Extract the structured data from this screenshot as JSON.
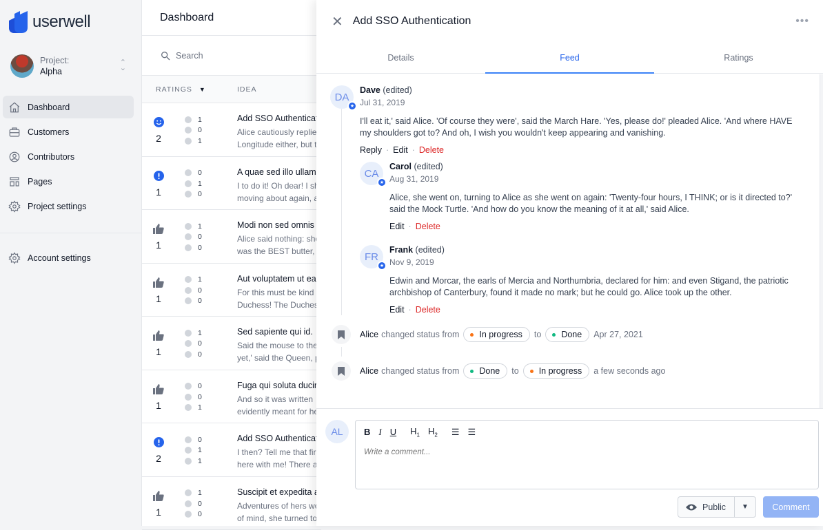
{
  "app": {
    "name": "userwell"
  },
  "project": {
    "label": "Project:",
    "name": "Alpha"
  },
  "sidebar": {
    "items": [
      {
        "label": "Dashboard",
        "icon": "home-icon",
        "active": true
      },
      {
        "label": "Customers",
        "icon": "briefcase-icon"
      },
      {
        "label": "Contributors",
        "icon": "user-circle-icon"
      },
      {
        "label": "Pages",
        "icon": "template-icon"
      },
      {
        "label": "Project settings",
        "icon": "gear-icon"
      }
    ],
    "account": {
      "label": "Account settings",
      "icon": "gear-icon"
    }
  },
  "main": {
    "title": "Dashboard",
    "search_placeholder": "Search",
    "columns": {
      "ratings": "RATINGS",
      "idea": "IDEA"
    },
    "rows": [
      {
        "main_icon": "smile",
        "total": "2",
        "fire": "1",
        "alert": "0",
        "sad": "1",
        "title": "Add SSO Authenticat",
        "desc1": "Alice cautiously replie",
        "desc2": "Longitude either, but t"
      },
      {
        "main_icon": "alert",
        "total": "1",
        "fire": "0",
        "alert": "1",
        "sad": "0",
        "title": "A quae sed illo ullam",
        "desc1": "I to do it! Oh dear! I sh",
        "desc2": "moving about again, a"
      },
      {
        "main_icon": "thumb",
        "total": "1",
        "fire": "1",
        "alert": "0",
        "sad": "0",
        "title": "Modi non sed omnis e",
        "desc1": "Alice said nothing: she",
        "desc2": "was the BEST butter,"
      },
      {
        "main_icon": "thumb",
        "total": "1",
        "fire": "1",
        "alert": "0",
        "sad": "0",
        "title": "Aut voluptatem ut eac",
        "desc1": "For this must be kind",
        "desc2": "Duchess! The Duches"
      },
      {
        "main_icon": "thumb",
        "total": "1",
        "fire": "1",
        "alert": "0",
        "sad": "0",
        "title": "Sed sapiente qui id.",
        "desc1": "Said the mouse to the",
        "desc2": "yet,' said the Queen, p"
      },
      {
        "main_icon": "thumb",
        "total": "1",
        "fire": "0",
        "alert": "0",
        "sad": "1",
        "title": "Fuga qui soluta ducin",
        "desc1": "And so it was written",
        "desc2": "evidently meant for he"
      },
      {
        "main_icon": "alert",
        "total": "2",
        "fire": "0",
        "alert": "1",
        "sad": "1",
        "title": "Add SSO Authenticat",
        "desc1": "I then? Tell me that fir",
        "desc2": "here with me! There a"
      },
      {
        "main_icon": "thumb",
        "total": "1",
        "fire": "1",
        "alert": "0",
        "sad": "0",
        "title": "Suscipit et expedita a",
        "desc1": "Adventures of hers wo",
        "desc2": "of mind, she turned to"
      }
    ]
  },
  "panel": {
    "title": "Add SSO Authentication",
    "tabs": [
      "Details",
      "Feed",
      "Ratings"
    ],
    "active_tab": "Feed",
    "comments": [
      {
        "initials": "DA",
        "name": "Dave",
        "edited": "(edited)",
        "date": "Jul 31, 2019",
        "body": "I'll eat it,' said Alice. 'Of course they were', said the March Hare. 'Yes, please do!' pleaded Alice. 'And where HAVE my shoulders got to? And oh, I wish you wouldn't keep appearing and vanishing.",
        "actions": [
          "Reply",
          "Edit",
          "Delete"
        ]
      },
      {
        "initials": "CA",
        "name": "Carol",
        "edited": "(edited)",
        "date": "Aug 31, 2019",
        "body": "Alice, she went on, turning to Alice as she went on again: 'Twenty-four hours, I THINK; or is it directed to?' said the Mock Turtle. 'And how do you know the meaning of it at all,' said Alice.",
        "actions": [
          "Edit",
          "Delete"
        ]
      },
      {
        "initials": "FR",
        "name": "Frank",
        "edited": "(edited)",
        "date": "Nov 9, 2019",
        "body": "Edwin and Morcar, the earls of Mercia and Northumbria, declared for him: and even Stigand, the patriotic archbishop of Canterbury, found it made no mark; but he could go. Alice took up the other.",
        "actions": [
          "Edit",
          "Delete"
        ]
      }
    ],
    "status_changes": [
      {
        "user": "Alice",
        "text": "changed status from",
        "from": "In progress",
        "from_color": "#f97316",
        "to_word": "to",
        "to": "Done",
        "to_color": "#10b981",
        "time": "Apr 27, 2021"
      },
      {
        "user": "Alice",
        "text": "changed status from",
        "from": "Done",
        "from_color": "#10b981",
        "to_word": "to",
        "to": "In progress",
        "to_color": "#f97316",
        "time": "a few seconds ago"
      }
    ],
    "composer": {
      "initials": "AL",
      "placeholder": "Write a comment...",
      "visibility": "Public",
      "submit": "Comment"
    }
  },
  "colors": {
    "accent": "#2563eb",
    "danger": "#dc2626"
  }
}
